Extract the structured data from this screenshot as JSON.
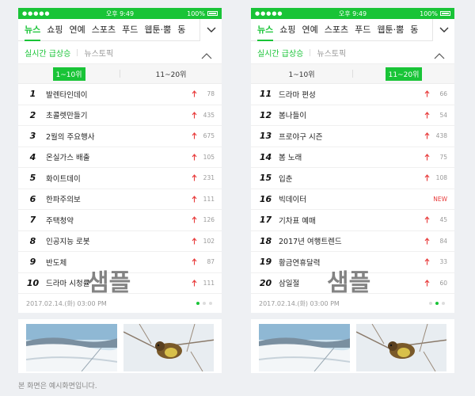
{
  "status": {
    "dots": "●●●●●",
    "time": "오후 9:49",
    "battery": "100%"
  },
  "nav_tabs": [
    "뉴스",
    "쇼핑",
    "연예",
    "스포츠",
    "푸드",
    "웹툰·뿜",
    "동"
  ],
  "section": {
    "tab_realtime": "실시간 급상승",
    "tab_topic": "뉴스토픽"
  },
  "rank_tabs": {
    "first": "1~10위",
    "second": "11~20위"
  },
  "left": {
    "active_rank_tab": "first",
    "items": [
      {
        "rank": "1",
        "keyword": "발렌타인데이",
        "change": "78"
      },
      {
        "rank": "2",
        "keyword": "초콜렛만들기",
        "change": "435"
      },
      {
        "rank": "3",
        "keyword": "2월의 주요행사",
        "change": "675"
      },
      {
        "rank": "4",
        "keyword": "온실가스 배출",
        "change": "105"
      },
      {
        "rank": "5",
        "keyword": "화이트데이",
        "change": "231"
      },
      {
        "rank": "6",
        "keyword": "한파주의보",
        "change": "111"
      },
      {
        "rank": "7",
        "keyword": "주택청약",
        "change": "126"
      },
      {
        "rank": "8",
        "keyword": "인공지능 로봇",
        "change": "102"
      },
      {
        "rank": "9",
        "keyword": "반도체",
        "change": "87"
      },
      {
        "rank": "10",
        "keyword": "드라마 시청률",
        "change": "111"
      }
    ],
    "timestamp": "2017.02.14.(화) 03:00 PM",
    "active_page": 1,
    "watermark": "샘플"
  },
  "right": {
    "active_rank_tab": "second",
    "items": [
      {
        "rank": "11",
        "keyword": "드라마 편성",
        "change": "66"
      },
      {
        "rank": "12",
        "keyword": "봄나들이",
        "change": "54"
      },
      {
        "rank": "13",
        "keyword": "프로야구 시즌",
        "change": "438"
      },
      {
        "rank": "14",
        "keyword": "봄 노래",
        "change": "75"
      },
      {
        "rank": "15",
        "keyword": "입춘",
        "change": "108"
      },
      {
        "rank": "16",
        "keyword": "빅데이터",
        "change": "NEW"
      },
      {
        "rank": "17",
        "keyword": "기차표 예매",
        "change": "45"
      },
      {
        "rank": "18",
        "keyword": "2017년 여행트렌드",
        "change": "84"
      },
      {
        "rank": "19",
        "keyword": "황금연휴달력",
        "change": "33"
      },
      {
        "rank": "20",
        "keyword": "삼일절",
        "change": "60"
      }
    ],
    "timestamp": "2017.02.14.(화) 03:00 PM",
    "active_page": 2,
    "watermark": "샘플"
  },
  "caption": "본 화면은 예시화면입니다.",
  "colors": {
    "accent": "#19c437",
    "rise": "#e83a3a",
    "background": "#eef0f3"
  }
}
